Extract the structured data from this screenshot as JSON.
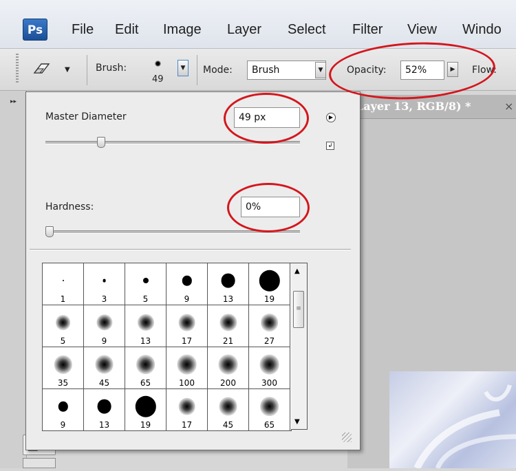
{
  "menu": {
    "logo": "Ps",
    "items": [
      "File",
      "Edit",
      "Image",
      "Layer",
      "Select",
      "Filter",
      "View",
      "Windo"
    ]
  },
  "options": {
    "brush_label": "Brush:",
    "brush_size": "49",
    "mode_label": "Mode:",
    "mode_value": "Brush",
    "opacity_label": "Opacity:",
    "opacity_value": "52%",
    "flow_label": "Flow:"
  },
  "document": {
    "tab_title": "Layer 13, RGB/8) *",
    "close_glyph": "×"
  },
  "brush_panel": {
    "master_diameter_label": "Master Diameter",
    "master_diameter_value": "49 px",
    "master_diameter_level": 0.21,
    "hardness_label": "Hardness:",
    "hardness_value": "0%",
    "hardness_level": 0.0,
    "presets": [
      {
        "size": "1",
        "soft": false
      },
      {
        "size": "3",
        "soft": false
      },
      {
        "size": "5",
        "soft": false
      },
      {
        "size": "9",
        "soft": false
      },
      {
        "size": "13",
        "soft": false
      },
      {
        "size": "19",
        "soft": false
      },
      {
        "size": "5",
        "soft": true
      },
      {
        "size": "9",
        "soft": true
      },
      {
        "size": "13",
        "soft": true
      },
      {
        "size": "17",
        "soft": true
      },
      {
        "size": "21",
        "soft": true
      },
      {
        "size": "27",
        "soft": true
      },
      {
        "size": "35",
        "soft": true
      },
      {
        "size": "45",
        "soft": true
      },
      {
        "size": "65",
        "soft": true
      },
      {
        "size": "100",
        "soft": true
      },
      {
        "size": "200",
        "soft": true
      },
      {
        "size": "300",
        "soft": true
      },
      {
        "size": "9",
        "soft": false
      },
      {
        "size": "13",
        "soft": false
      },
      {
        "size": "19",
        "soft": false
      },
      {
        "size": "17",
        "soft": true
      },
      {
        "size": "45",
        "soft": true
      },
      {
        "size": "65",
        "soft": true
      }
    ]
  },
  "colors": {
    "annotation_ring": "#d4161d",
    "ps_logo": "#2a64b4"
  }
}
